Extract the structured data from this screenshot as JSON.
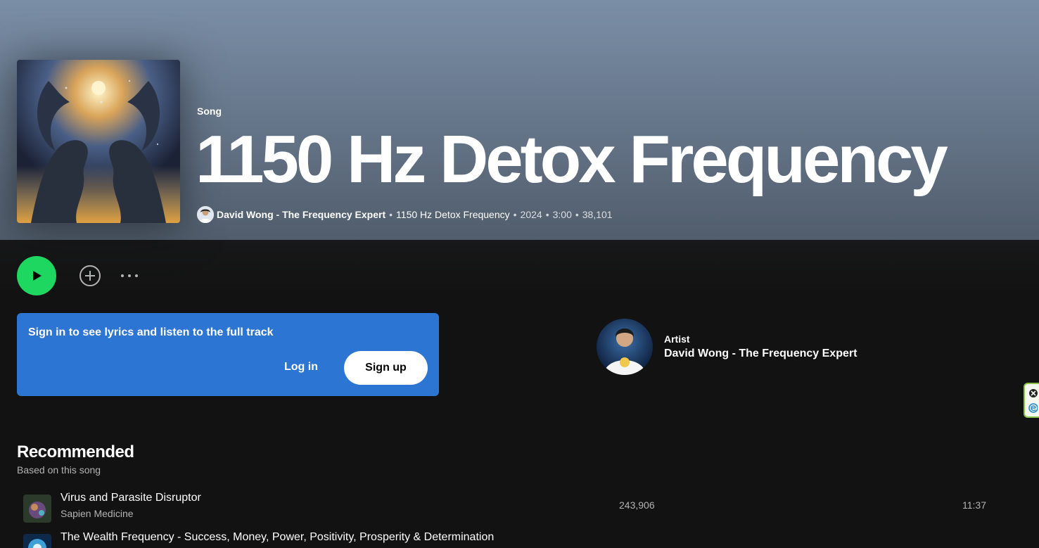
{
  "hero": {
    "type_label": "Song",
    "title": "1150 Hz Detox Frequency",
    "artist": "David Wong - The Frequency Expert",
    "album": "1150 Hz Detox Frequency",
    "year": "2024",
    "duration": "3:00",
    "play_count": "38,101",
    "separator": "•"
  },
  "controls": {
    "play_icon": "play-icon",
    "add_icon": "add-circle-icon",
    "more_icon": "more-options-icon"
  },
  "signin_card": {
    "message": "Sign in to see lyrics and listen to the full track",
    "login_label": "Log in",
    "signup_label": "Sign up"
  },
  "artist_card": {
    "label": "Artist",
    "name": "David Wong - The Frequency Expert"
  },
  "recommended": {
    "title": "Recommended",
    "subtitle": "Based on this song",
    "tracks": [
      {
        "title": "Virus and Parasite Disruptor",
        "artist": "Sapien Medicine",
        "plays": "243,906",
        "duration": "11:37"
      },
      {
        "title": "The Wealth Frequency - Success, Money, Power, Positivity, Prosperity & Determination",
        "artist": "",
        "plays": "",
        "duration": ""
      }
    ]
  },
  "colors": {
    "accent_green": "#1ed760",
    "signin_blue": "#2d75d2",
    "hero_top": "#7a8ea6",
    "background": "#121212"
  }
}
